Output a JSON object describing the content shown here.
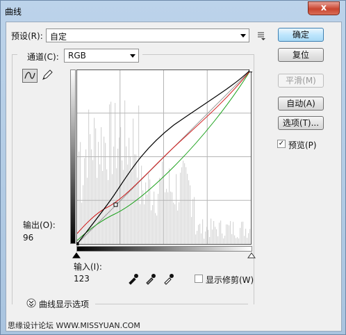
{
  "window": {
    "title": "曲线",
    "close_glyph": "x"
  },
  "preset": {
    "label": "预设(R):",
    "value": "自定"
  },
  "channel": {
    "label": "通道(C):",
    "value": "RGB"
  },
  "buttons": {
    "ok": "确定",
    "reset": "复位",
    "smooth": "平滑(M)",
    "auto": "自动(A)",
    "options": "选项(T)..."
  },
  "preview": {
    "label": "预览(P)",
    "checked": true
  },
  "output": {
    "label": "输出(O):",
    "value": "96"
  },
  "input": {
    "label": "输入(I):",
    "value": "123"
  },
  "show_clipping": {
    "label": "显示修剪(W)",
    "checked": false
  },
  "display_options": {
    "label": "曲线显示选项"
  },
  "footer": {
    "watermark": "思缘设计论坛  WWW.MISSYUAN.COM"
  },
  "colors": {
    "accent": "#3c7fb1",
    "window_frame": "#b2cbe5",
    "curve_main": "#000000",
    "curve_red": "#d01818",
    "curve_green": "#18a018"
  }
}
